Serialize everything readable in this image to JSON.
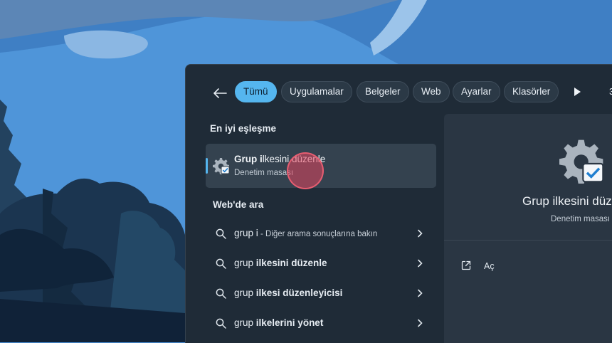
{
  "colors": {
    "accent": "#55b6ef",
    "panel": "#1f2b37",
    "cursor": "#e1465f"
  },
  "tabs": {
    "back_icon": "arrow-left-icon",
    "items": [
      {
        "label": "Tümü",
        "active": true
      },
      {
        "label": "Uygulamalar",
        "active": false
      },
      {
        "label": "Belgeler",
        "active": false
      },
      {
        "label": "Web",
        "active": false
      },
      {
        "label": "Ayarlar",
        "active": false
      },
      {
        "label": "Klasörler",
        "active": false
      }
    ],
    "more_icon": "play-icon",
    "overflow_text": "3"
  },
  "best_match": {
    "heading": "En iyi eşleşme",
    "title_bold": "Grup i",
    "title_rest": "lkesini düzenle",
    "subtitle": "Denetim masası",
    "icon": "gear-with-checkbox-icon"
  },
  "web_search": {
    "heading": "Web'de ara",
    "items": [
      {
        "query": "grup i",
        "suffix": " - Diğer arama sonuçlarına bakın",
        "bold": ""
      },
      {
        "query": "grup ",
        "bold": "ilkesini düzenle",
        "suffix": ""
      },
      {
        "query": "grup ",
        "bold": "ilkesi düzenleyicisi",
        "suffix": ""
      },
      {
        "query": "grup ",
        "bold": "ilkelerini yönet",
        "suffix": ""
      }
    ]
  },
  "preview": {
    "title": "Grup ilkesini düz",
    "subtitle": "Denetim masası",
    "action_open": "Aç",
    "action_icon": "open-external-icon"
  }
}
